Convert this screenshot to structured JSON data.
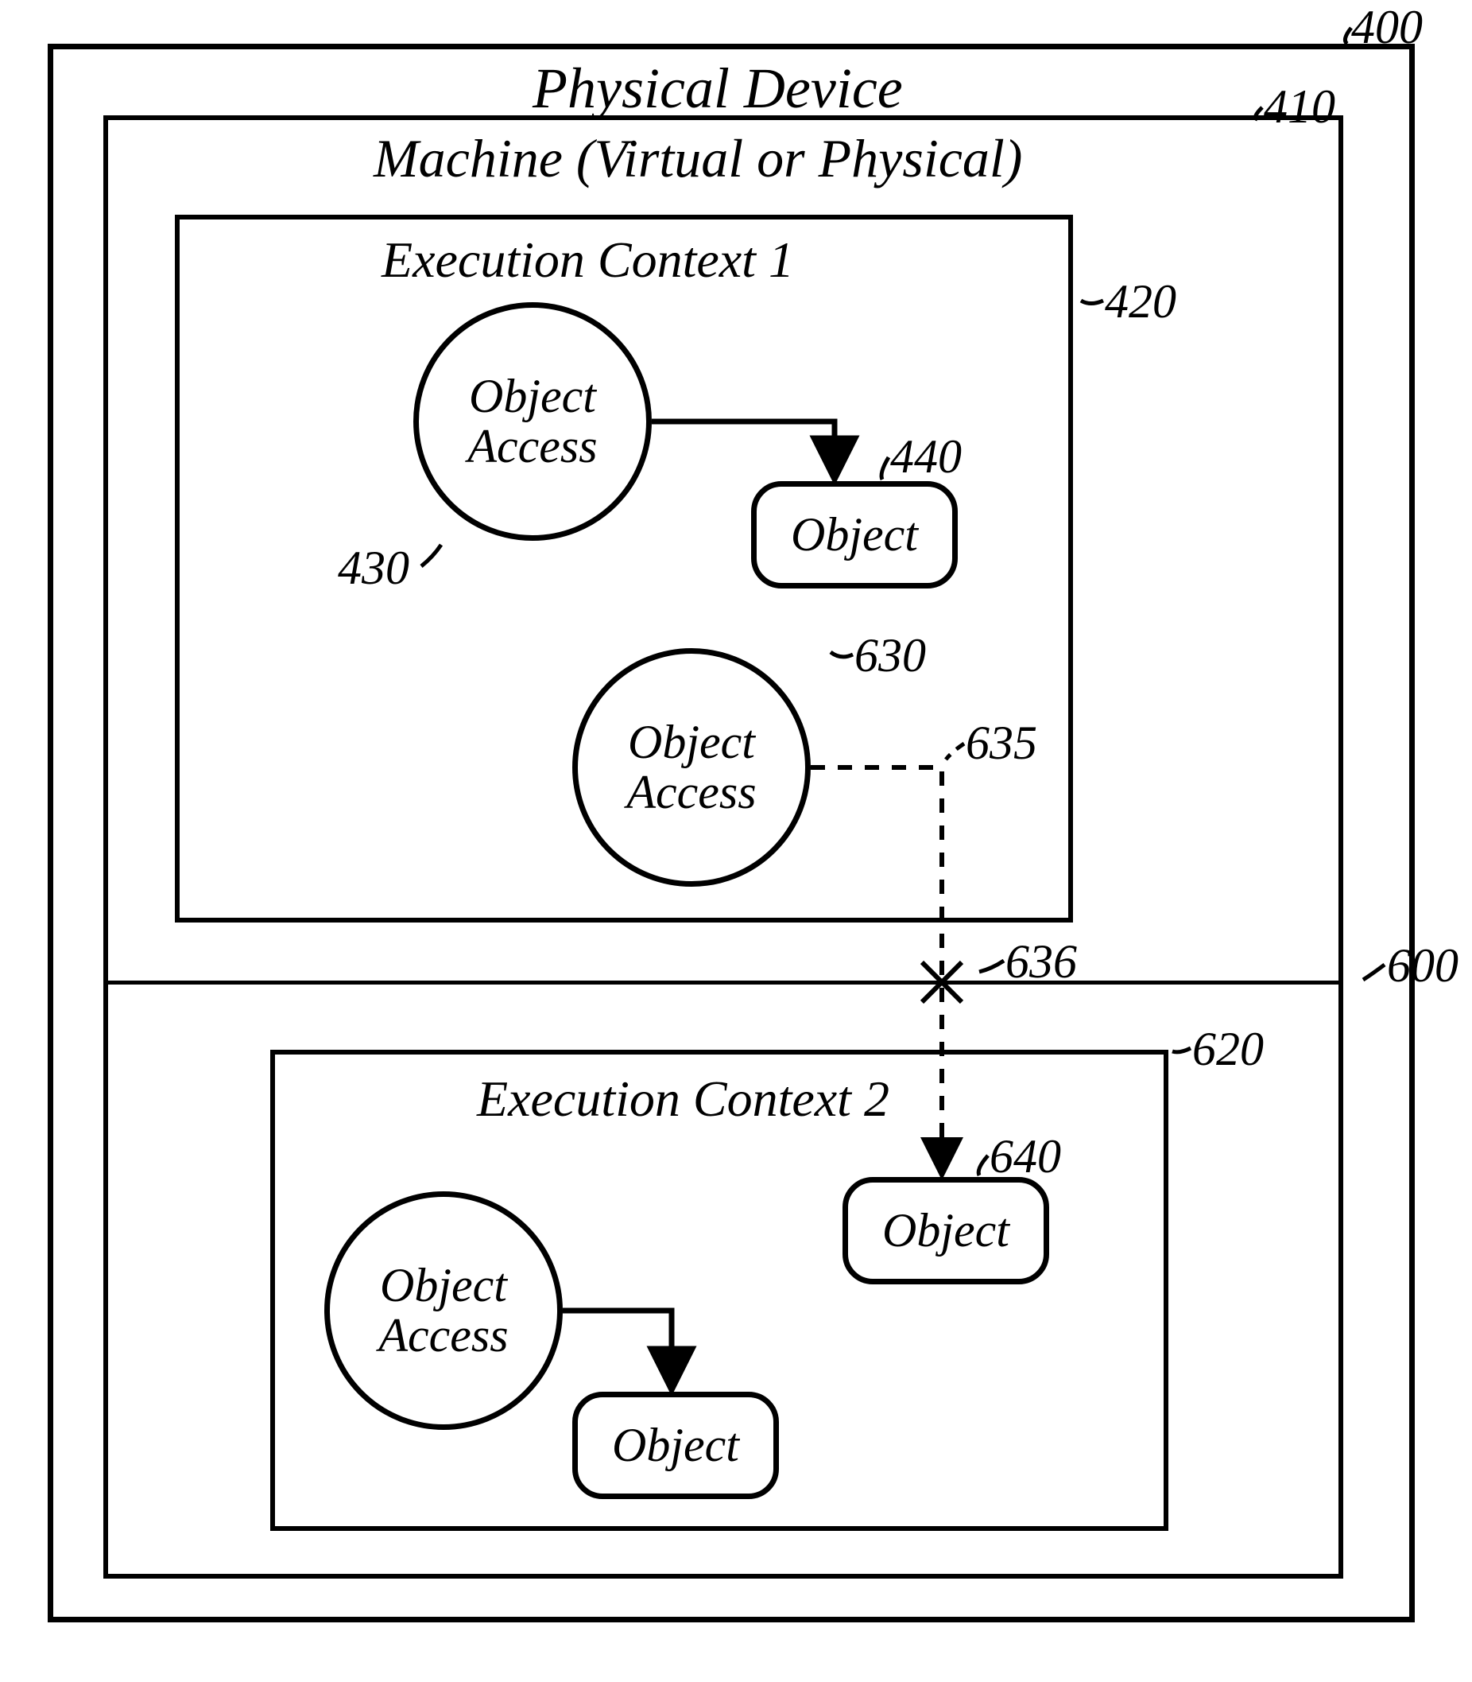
{
  "labels": {
    "physical_device": "Physical Device",
    "machine": "Machine (Virtual or Physical)",
    "exec1": "Execution Context 1",
    "exec2": "Execution Context 2",
    "object_access": "Object\nAccess",
    "object": "Object"
  },
  "refs": {
    "r400": "400",
    "r410": "410",
    "r420": "420",
    "r430": "430",
    "r440": "440",
    "r600": "600",
    "r620": "620",
    "r630": "630",
    "r635": "635",
    "r636": "636",
    "r640": "640"
  }
}
